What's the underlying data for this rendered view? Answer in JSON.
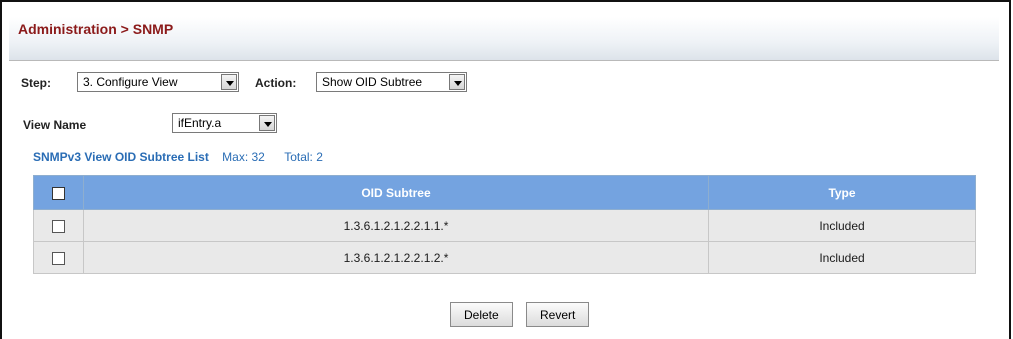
{
  "header": {
    "title": "Administration > SNMP"
  },
  "controls": {
    "step_label": "Step:",
    "step_value": "3. Configure View",
    "action_label": "Action:",
    "action_value": "Show OID Subtree",
    "view_name_label": "View Name",
    "view_name_value": "ifEntry.a"
  },
  "list": {
    "title": "SNMPv3 View OID Subtree List",
    "max_text": "Max: 32",
    "total_text": "Total: 2",
    "columns": [
      "OID Subtree",
      "Type"
    ],
    "rows": [
      {
        "oid": "1.3.6.1.2.1.2.2.1.1.*",
        "type": "Included"
      },
      {
        "oid": "1.3.6.1.2.1.2.2.1.2.*",
        "type": "Included"
      }
    ]
  },
  "buttons": {
    "delete": "Delete",
    "revert": "Revert"
  },
  "colors": {
    "title": "#8b1a1a",
    "header_bg": "#74a3e0",
    "link": "#2a6db5",
    "row_bg": "#e9e9e9"
  }
}
